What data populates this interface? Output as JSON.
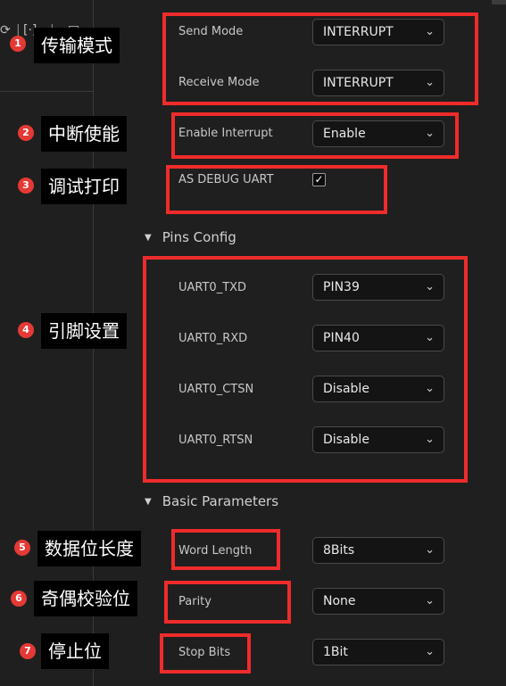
{
  "toolbar": {
    "icons": [
      "refresh-icon",
      "bracket-icon",
      "split-icon",
      "file-icon"
    ]
  },
  "transfer": {
    "send_mode_label": "Send Mode",
    "send_mode_value": "INTERRUPT",
    "receive_mode_label": "Receive Mode",
    "receive_mode_value": "INTERRUPT"
  },
  "interrupt": {
    "label": "Enable Interrupt",
    "value": "Enable"
  },
  "debug": {
    "label": "AS DEBUG UART",
    "checked": true
  },
  "pins_section": {
    "title": "Pins Config"
  },
  "pins": {
    "txd_label": "UART0_TXD",
    "txd_value": "PIN39",
    "rxd_label": "UART0_RXD",
    "rxd_value": "PIN40",
    "ctsn_label": "UART0_CTSN",
    "ctsn_value": "Disable",
    "rtsn_label": "UART0_RTSN",
    "rtsn_value": "Disable"
  },
  "basic_section": {
    "title": "Basic Parameters"
  },
  "basic": {
    "word_length_label": "Word Length",
    "word_length_value": "8Bits",
    "parity_label": "Parity",
    "parity_value": "None",
    "stop_bits_label": "Stop Bits",
    "stop_bits_value": "1Bit"
  },
  "annotations": [
    {
      "num": "1",
      "text": "传输模式"
    },
    {
      "num": "2",
      "text": "中断使能"
    },
    {
      "num": "3",
      "text": "调试打印"
    },
    {
      "num": "4",
      "text": "引脚设置"
    },
    {
      "num": "5",
      "text": "数据位长度"
    },
    {
      "num": "6",
      "text": "奇偶校验位"
    },
    {
      "num": "7",
      "text": "停止位"
    }
  ],
  "colors": {
    "highlight": "#ef2b2b",
    "badge": "#e53935",
    "background": "#1f1f1f"
  }
}
